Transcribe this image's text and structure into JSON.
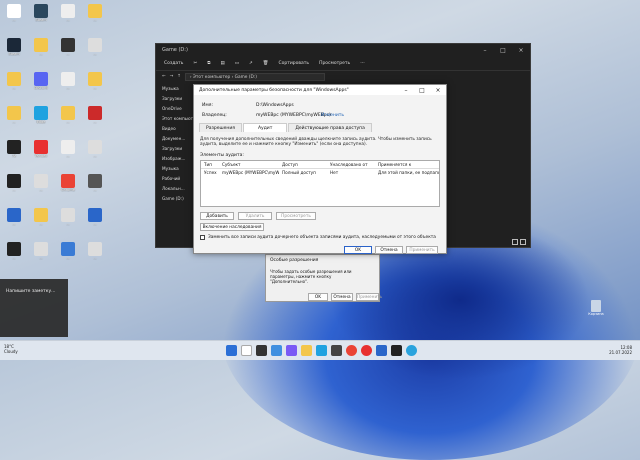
{
  "desktop": {
    "icons": [
      {
        "label": "...",
        "color": "#ffffff"
      },
      {
        "label": "Steam",
        "color": "#2a475e"
      },
      {
        "label": "...",
        "color": "#eeeeee"
      },
      {
        "label": "...",
        "color": "#f3c64b"
      },
      {
        "label": "Steam",
        "color": "#1b2838"
      },
      {
        "label": "...",
        "color": "#f3c64b"
      },
      {
        "label": "...",
        "color": "#333333"
      },
      {
        "label": "...",
        "color": "#dddddd"
      },
      {
        "label": "...",
        "color": "#f3c64b"
      },
      {
        "label": "Discord",
        "color": "#5865f2"
      },
      {
        "label": "...",
        "color": "#eeeeee"
      },
      {
        "label": "...",
        "color": "#f3c64b"
      },
      {
        "label": "...",
        "color": "#f3c64b"
      },
      {
        "label": "Edge",
        "color": "#1fa2e0"
      },
      {
        "label": "...",
        "color": "#f3c64b"
      },
      {
        "label": "...",
        "color": "#cc2a2a"
      },
      {
        "label": "7z",
        "color": "#222222"
      },
      {
        "label": "Yandex",
        "color": "#e83030"
      },
      {
        "label": "...",
        "color": "#eeeeee"
      },
      {
        "label": "...",
        "color": "#dddddd"
      },
      {
        "label": "...",
        "color": "#222222"
      },
      {
        "label": "...",
        "color": "#dddddd"
      },
      {
        "label": "Chrome",
        "color": "#ea4335"
      },
      {
        "label": "...",
        "color": "#555555"
      },
      {
        "label": "...",
        "color": "#2a66c9"
      },
      {
        "label": "...",
        "color": "#f3c64b"
      },
      {
        "label": "...",
        "color": "#dddddd"
      },
      {
        "label": "...",
        "color": "#2a66c9"
      },
      {
        "label": "...",
        "color": "#222222"
      },
      {
        "label": "...",
        "color": "#dddddd"
      },
      {
        "label": "...",
        "color": "#3a7bd5"
      },
      {
        "label": "...",
        "color": "#dddddd"
      }
    ]
  },
  "explorer": {
    "title": "Game (D:)",
    "toolbar": {
      "new": "Создать",
      "sort": "Сортировать",
      "view": "Просмотреть"
    },
    "address": "› Этот компьютер › Game (D:)",
    "nav": [
      "Музыка",
      "Загрузки",
      "OneDrive",
      "Этот компьютер",
      "Видео",
      "Докумен...",
      "Загрузки",
      "Изображ...",
      "Музыка",
      "Рабочий",
      "Локальн...",
      "Game (D:)"
    ]
  },
  "security_dialog": {
    "title": "Дополнительные параметры безопасности для \"WindowsApps\"",
    "name_label": "Имя:",
    "name_value": "D:\\WindowsApps",
    "owner_label": "Владелец:",
    "owner_value": "myWEBpc (MYWEBPC\\myWEBpc)",
    "owner_change": "Изменить",
    "tabs": [
      "Разрешения",
      "Аудит",
      "Действующие права доступа"
    ],
    "description": "Для получения дополнительных сведений дважды щелкните запись аудита. Чтобы изменить запись аудита, выделите ее и нажмите кнопку \"Изменить\" (если она доступна).",
    "entries_label": "Элементы аудита:",
    "columns": [
      "Тип",
      "Субъект",
      "Доступ",
      "Унаследовано от",
      "Применяется к"
    ],
    "rows": [
      [
        "Успех",
        "myWEBpc (MYWEBPC\\myWEBpc)",
        "Полный доступ",
        "Нет",
        "Для этой папки, ее подпапок ..."
      ]
    ],
    "btn_add": "Добавить",
    "btn_remove": "Удалить",
    "btn_view": "Просмотреть",
    "btn_inheritance": "Включение наследования",
    "replace_label": "Заменить все записи аудита дочернего объекта записями аудита, наследуемыми от этого объекта",
    "btn_ok": "OK",
    "btn_cancel": "Отмена",
    "btn_apply": "Применить"
  },
  "back_dialog": {
    "line1": "Особые разрешения",
    "line2": "Чтобы задать особые разрешения или параметры, нажмите кнопку \"Дополнительно\".",
    "btn_ok": "OK",
    "btn_cancel": "Отмена",
    "btn_apply": "Применить"
  },
  "toast": {
    "text": "Напишите заметку..."
  },
  "taskbar": {
    "weather_temp": "18°C",
    "weather_desc": "Cloudy",
    "time": "12:08",
    "date": "21.07.2022"
  },
  "recycle_bin": {
    "label": "Корзина"
  }
}
